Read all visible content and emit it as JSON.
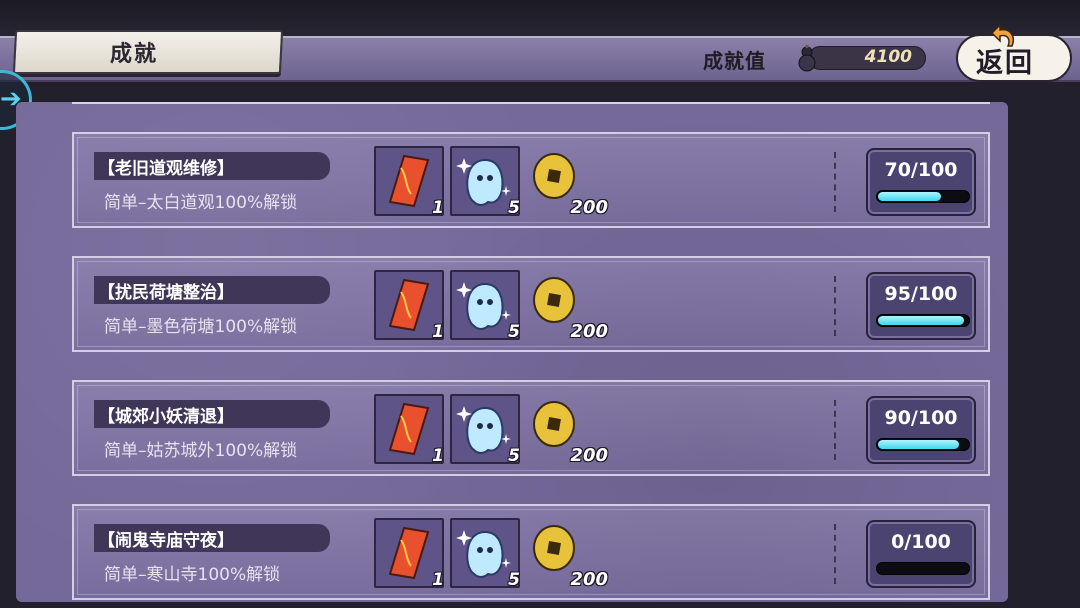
{
  "header": {
    "title": "成就",
    "score_label": "成就值",
    "score_value": "4100",
    "back_label": "返回"
  },
  "colors": {
    "accent_cyan": "#40d6ec",
    "panel": "#75699a",
    "name_plate": "#3f3658"
  },
  "achievements": [
    {
      "name": "【老旧道观维修】",
      "desc": "简单–太白道观100%解锁",
      "rewards": {
        "talisman": "1",
        "spirit": "5",
        "coin": "200"
      },
      "progress_text": "70/100",
      "progress": 0.7
    },
    {
      "name": "【扰民荷塘整治】",
      "desc": "简单–墨色荷塘100%解锁",
      "rewards": {
        "talisman": "1",
        "spirit": "5",
        "coin": "200"
      },
      "progress_text": "95/100",
      "progress": 0.95
    },
    {
      "name": "【城郊小妖清退】",
      "desc": "简单–姑苏城外100%解锁",
      "rewards": {
        "talisman": "1",
        "spirit": "5",
        "coin": "200"
      },
      "progress_text": "90/100",
      "progress": 0.9
    },
    {
      "name": "【闹鬼寺庙守夜】",
      "desc": "简单–寒山寺100%解锁",
      "rewards": {
        "talisman": "1",
        "spirit": "5",
        "coin": "200"
      },
      "progress_text": "0/100",
      "progress": 0.0
    }
  ],
  "icons": {
    "reward_1": "talisman-icon",
    "reward_2": "spirit-icon",
    "reward_3": "coin-icon",
    "score": "gourd-icon",
    "back": "back-arrow-icon",
    "side": "expand-arrow-icon"
  }
}
